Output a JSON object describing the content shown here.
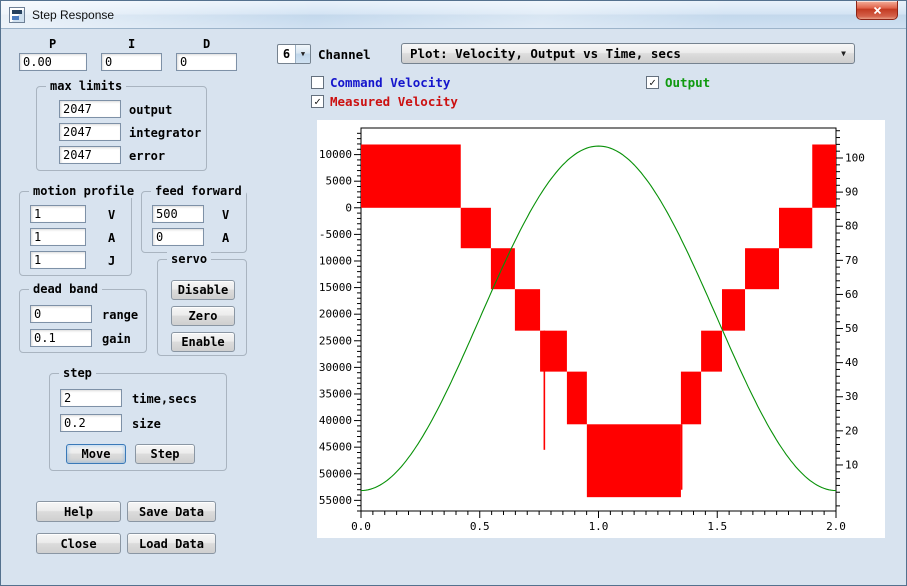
{
  "window": {
    "title": "Step Response"
  },
  "pid": {
    "p_label": "P",
    "p_value": "0.00",
    "i_label": "I",
    "i_value": "0",
    "d_label": "D",
    "d_value": "0"
  },
  "max_limits": {
    "title": "max limits",
    "rows": [
      {
        "value": "2047",
        "label": "output"
      },
      {
        "value": "2047",
        "label": "integrator"
      },
      {
        "value": "2047",
        "label": "error"
      }
    ]
  },
  "motion_profile": {
    "title": "motion profile",
    "rows": [
      {
        "value": "1",
        "label": "V"
      },
      {
        "value": "1",
        "label": "A"
      },
      {
        "value": "1",
        "label": "J"
      }
    ]
  },
  "feed_forward": {
    "title": "feed forward",
    "rows": [
      {
        "value": "500",
        "label": "V"
      },
      {
        "value": "0",
        "label": "A"
      }
    ]
  },
  "servo": {
    "title": "servo",
    "buttons": [
      "Disable",
      "Zero",
      "Enable"
    ]
  },
  "dead_band": {
    "title": "dead band",
    "rows": [
      {
        "value": "0",
        "label": "range"
      },
      {
        "value": "0.1",
        "label": "gain"
      }
    ]
  },
  "step": {
    "title": "step",
    "rows": [
      {
        "value": "2",
        "label": "time,secs"
      },
      {
        "value": "0.2",
        "label": "size"
      }
    ],
    "buttons": [
      "Move",
      "Step"
    ]
  },
  "bottom_buttons": [
    "Help",
    "Save Data",
    "Close",
    "Load Data"
  ],
  "channel": {
    "value": "6",
    "label": "Channel"
  },
  "plot_select": {
    "value": "Plot: Velocity, Output vs Time, secs"
  },
  "checkboxes": [
    {
      "label": "Command Velocity",
      "checked": false,
      "color": "#1515cc"
    },
    {
      "label": "Measured Velocity",
      "checked": true,
      "color": "#cc1010"
    },
    {
      "label": "Output",
      "checked": true,
      "color": "#0f9a0f"
    }
  ],
  "chart_data": {
    "type": "line",
    "x_axis": {
      "range": [
        0,
        2
      ],
      "major_ticks": [
        0,
        0.5,
        1,
        1.5,
        2
      ],
      "minor_step": 0.05
    },
    "left_axis": {
      "range": [
        -57000,
        15000
      ],
      "major_ticks": [
        10000,
        5000,
        0,
        -5000,
        -10000,
        -15000,
        -20000,
        -25000,
        -30000,
        -35000,
        -40000,
        -45000,
        -50000,
        -55000
      ],
      "minor_step": 1000,
      "series": "Measured Velocity"
    },
    "right_axis": {
      "range": [
        -3.5,
        108.8
      ],
      "major_ticks": [
        100,
        90,
        80,
        70,
        60,
        50,
        40,
        30,
        20,
        10
      ],
      "minor_step": 2,
      "series": "Output"
    },
    "series": [
      {
        "name": "Measured Velocity",
        "color": "#ff0000",
        "axis": "left",
        "style": "filled-steps",
        "steps": [
          {
            "t0": 0.0,
            "t1": 0.42,
            "low": 0,
            "high": 11900
          },
          {
            "t0": 0.42,
            "t1": 0.547,
            "low": -7600,
            "high": 0
          },
          {
            "t0": 0.547,
            "t1": 0.648,
            "low": -15300,
            "high": -7600
          },
          {
            "t0": 0.648,
            "t1": 0.754,
            "low": -23100,
            "high": -15300
          },
          {
            "t0": 0.754,
            "t1": 0.867,
            "low": -30800,
            "high": -23100
          },
          {
            "t0": 0.867,
            "t1": 0.951,
            "low": -40700,
            "high": -30800
          },
          {
            "t0": 0.951,
            "t1": 1.347,
            "low": -54400,
            "high": -40700
          },
          {
            "t0": 1.347,
            "t1": 1.432,
            "low": -40700,
            "high": -30800
          },
          {
            "t0": 1.432,
            "t1": 1.52,
            "low": -30800,
            "high": -23100
          },
          {
            "t0": 1.52,
            "t1": 1.617,
            "low": -23100,
            "high": -15300
          },
          {
            "t0": 1.617,
            "t1": 1.76,
            "low": -15300,
            "high": -7600
          },
          {
            "t0": 1.76,
            "t1": 1.9,
            "low": -7600,
            "high": 0
          },
          {
            "t0": 1.9,
            "t1": 2.0,
            "low": 0,
            "high": 11900
          }
        ],
        "spikes": [
          {
            "t": 0.772,
            "from": -45500,
            "to": -23100
          },
          {
            "t": 1.35,
            "from": -53000,
            "to": -40700
          }
        ]
      },
      {
        "name": "Output",
        "color": "#089108",
        "axis": "right",
        "style": "line",
        "curve": {
          "shape": "offset + amplitude*sin(pi*t/2)^2",
          "offset": 2.5,
          "amplitude": 101
        },
        "points": [
          [
            0,
            2.5
          ],
          [
            0.1,
            5.0
          ],
          [
            0.2,
            12.1
          ],
          [
            0.3,
            23.3
          ],
          [
            0.4,
            37.4
          ],
          [
            0.5,
            53.0
          ],
          [
            0.6,
            68.6
          ],
          [
            0.7,
            82.7
          ],
          [
            0.8,
            93.9
          ],
          [
            0.9,
            101.1
          ],
          [
            1.0,
            103.5
          ],
          [
            1.1,
            101.1
          ],
          [
            1.2,
            93.9
          ],
          [
            1.3,
            82.7
          ],
          [
            1.4,
            68.6
          ],
          [
            1.5,
            53.0
          ],
          [
            1.6,
            37.4
          ],
          [
            1.7,
            23.3
          ],
          [
            1.8,
            12.1
          ],
          [
            1.9,
            5.0
          ],
          [
            2.0,
            2.5
          ]
        ]
      }
    ]
  }
}
